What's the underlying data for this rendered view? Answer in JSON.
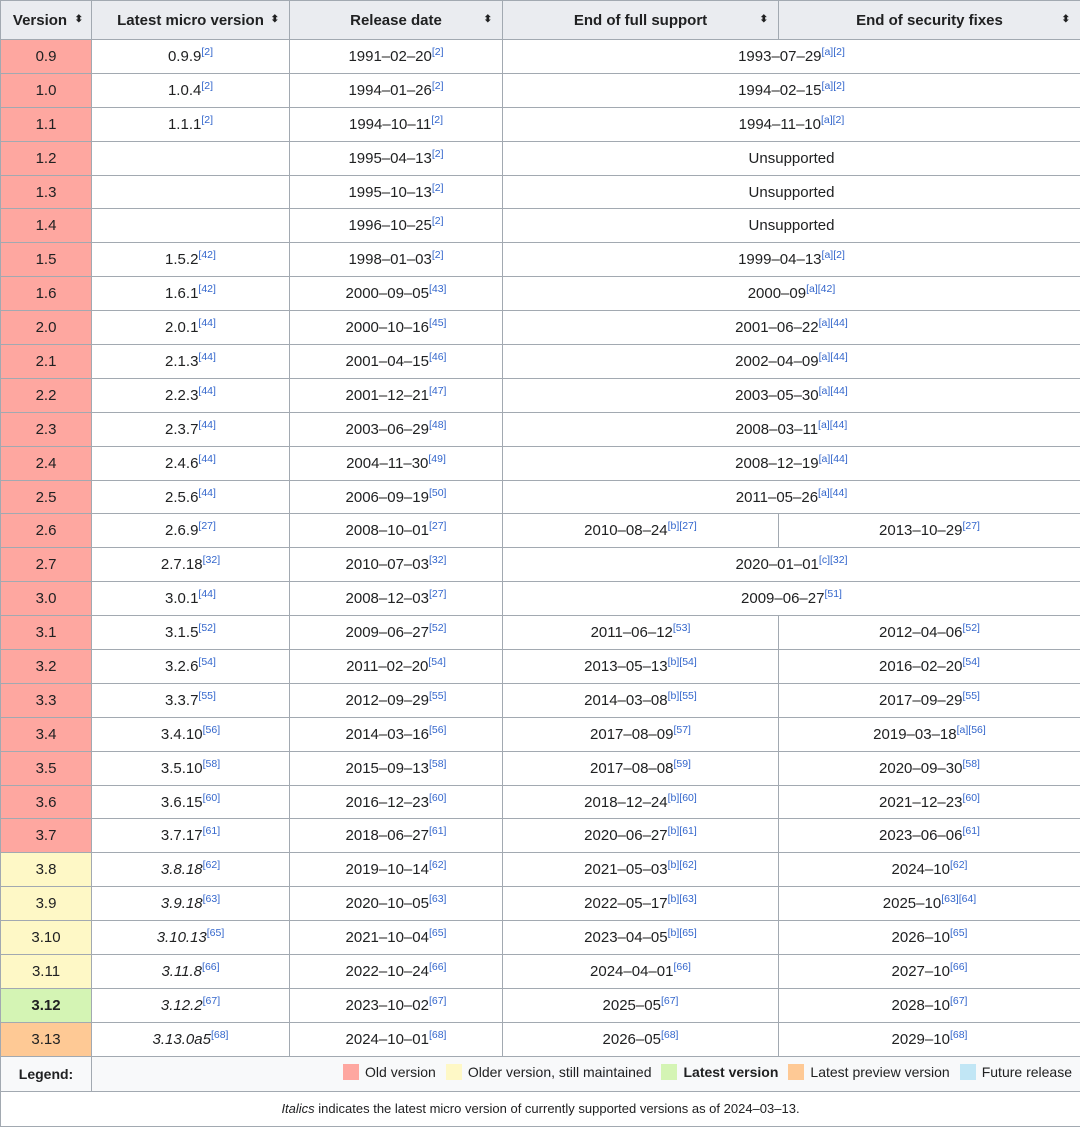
{
  "colors": {
    "old": "#fea7a0",
    "older_maintained": "#fef8c6",
    "latest": "#d4f4b4",
    "preview": "#fec995",
    "future": "#c1e6f5",
    "header_bg": "#eaecf0",
    "link": "#3366cc"
  },
  "headers": {
    "version": "Version",
    "micro": "Latest micro version",
    "release": "Release date",
    "full_support": "End of full support",
    "security": "End of security fixes",
    "sort_icon": "⬍"
  },
  "rows": [
    {
      "version": "0.9",
      "status": "old",
      "micro": "0.9.9",
      "micro_ref": "[2]",
      "micro_italic": false,
      "release": "1991–02–20",
      "release_ref": "[2]",
      "merged": true,
      "eol": "1993–07–29",
      "eol_ref": "[a][2]"
    },
    {
      "version": "1.0",
      "status": "old",
      "micro": "1.0.4",
      "micro_ref": "[2]",
      "micro_italic": false,
      "release": "1994–01–26",
      "release_ref": "[2]",
      "merged": true,
      "eol": "1994–02–15",
      "eol_ref": "[a][2]"
    },
    {
      "version": "1.1",
      "status": "old",
      "micro": "1.1.1",
      "micro_ref": "[2]",
      "micro_italic": false,
      "release": "1994–10–11",
      "release_ref": "[2]",
      "merged": true,
      "eol": "1994–11–10",
      "eol_ref": "[a][2]"
    },
    {
      "version": "1.2",
      "status": "old",
      "micro": "",
      "micro_ref": "",
      "micro_italic": false,
      "release": "1995–04–13",
      "release_ref": "[2]",
      "merged": true,
      "eol": "Unsupported",
      "eol_ref": ""
    },
    {
      "version": "1.3",
      "status": "old",
      "micro": "",
      "micro_ref": "",
      "micro_italic": false,
      "release": "1995–10–13",
      "release_ref": "[2]",
      "merged": true,
      "eol": "Unsupported",
      "eol_ref": ""
    },
    {
      "version": "1.4",
      "status": "old",
      "micro": "",
      "micro_ref": "",
      "micro_italic": false,
      "release": "1996–10–25",
      "release_ref": "[2]",
      "merged": true,
      "eol": "Unsupported",
      "eol_ref": ""
    },
    {
      "version": "1.5",
      "status": "old",
      "micro": "1.5.2",
      "micro_ref": "[42]",
      "micro_italic": false,
      "release": "1998–01–03",
      "release_ref": "[2]",
      "merged": true,
      "eol": "1999–04–13",
      "eol_ref": "[a][2]"
    },
    {
      "version": "1.6",
      "status": "old",
      "micro": "1.6.1",
      "micro_ref": "[42]",
      "micro_italic": false,
      "release": "2000–09–05",
      "release_ref": "[43]",
      "merged": true,
      "eol": "2000–09",
      "eol_ref": "[a][42]"
    },
    {
      "version": "2.0",
      "status": "old",
      "micro": "2.0.1",
      "micro_ref": "[44]",
      "micro_italic": false,
      "release": "2000–10–16",
      "release_ref": "[45]",
      "merged": true,
      "eol": "2001–06–22",
      "eol_ref": "[a][44]"
    },
    {
      "version": "2.1",
      "status": "old",
      "micro": "2.1.3",
      "micro_ref": "[44]",
      "micro_italic": false,
      "release": "2001–04–15",
      "release_ref": "[46]",
      "merged": true,
      "eol": "2002–04–09",
      "eol_ref": "[a][44]"
    },
    {
      "version": "2.2",
      "status": "old",
      "micro": "2.2.3",
      "micro_ref": "[44]",
      "micro_italic": false,
      "release": "2001–12–21",
      "release_ref": "[47]",
      "merged": true,
      "eol": "2003–05–30",
      "eol_ref": "[a][44]"
    },
    {
      "version": "2.3",
      "status": "old",
      "micro": "2.3.7",
      "micro_ref": "[44]",
      "micro_italic": false,
      "release": "2003–06–29",
      "release_ref": "[48]",
      "merged": true,
      "eol": "2008–03–11",
      "eol_ref": "[a][44]"
    },
    {
      "version": "2.4",
      "status": "old",
      "micro": "2.4.6",
      "micro_ref": "[44]",
      "micro_italic": false,
      "release": "2004–11–30",
      "release_ref": "[49]",
      "merged": true,
      "eol": "2008–12–19",
      "eol_ref": "[a][44]"
    },
    {
      "version": "2.5",
      "status": "old",
      "micro": "2.5.6",
      "micro_ref": "[44]",
      "micro_italic": false,
      "release": "2006–09–19",
      "release_ref": "[50]",
      "merged": true,
      "eol": "2011–05–26",
      "eol_ref": "[a][44]"
    },
    {
      "version": "2.6",
      "status": "old",
      "micro": "2.6.9",
      "micro_ref": "[27]",
      "micro_italic": false,
      "release": "2008–10–01",
      "release_ref": "[27]",
      "merged": false,
      "full": "2010–08–24",
      "full_ref": "[b][27]",
      "sec": "2013–10–29",
      "sec_ref": "[27]"
    },
    {
      "version": "2.7",
      "status": "old",
      "micro": "2.7.18",
      "micro_ref": "[32]",
      "micro_italic": false,
      "release": "2010–07–03",
      "release_ref": "[32]",
      "merged": true,
      "eol": "2020–01–01",
      "eol_ref": "[c][32]"
    },
    {
      "version": "3.0",
      "status": "old",
      "micro": "3.0.1",
      "micro_ref": "[44]",
      "micro_italic": false,
      "release": "2008–12–03",
      "release_ref": "[27]",
      "merged": true,
      "eol": "2009–06–27",
      "eol_ref": "[51]"
    },
    {
      "version": "3.1",
      "status": "old",
      "micro": "3.1.5",
      "micro_ref": "[52]",
      "micro_italic": false,
      "release": "2009–06–27",
      "release_ref": "[52]",
      "merged": false,
      "full": "2011–06–12",
      "full_ref": "[53]",
      "sec": "2012–04–06",
      "sec_ref": "[52]"
    },
    {
      "version": "3.2",
      "status": "old",
      "micro": "3.2.6",
      "micro_ref": "[54]",
      "micro_italic": false,
      "release": "2011–02–20",
      "release_ref": "[54]",
      "merged": false,
      "full": "2013–05–13",
      "full_ref": "[b][54]",
      "sec": "2016–02–20",
      "sec_ref": "[54]"
    },
    {
      "version": "3.3",
      "status": "old",
      "micro": "3.3.7",
      "micro_ref": "[55]",
      "micro_italic": false,
      "release": "2012–09–29",
      "release_ref": "[55]",
      "merged": false,
      "full": "2014–03–08",
      "full_ref": "[b][55]",
      "sec": "2017–09–29",
      "sec_ref": "[55]"
    },
    {
      "version": "3.4",
      "status": "old",
      "micro": "3.4.10",
      "micro_ref": "[56]",
      "micro_italic": false,
      "release": "2014–03–16",
      "release_ref": "[56]",
      "merged": false,
      "full": "2017–08–09",
      "full_ref": "[57]",
      "sec": "2019–03–18",
      "sec_ref": "[a][56]"
    },
    {
      "version": "3.5",
      "status": "old",
      "micro": "3.5.10",
      "micro_ref": "[58]",
      "micro_italic": false,
      "release": "2015–09–13",
      "release_ref": "[58]",
      "merged": false,
      "full": "2017–08–08",
      "full_ref": "[59]",
      "sec": "2020–09–30",
      "sec_ref": "[58]"
    },
    {
      "version": "3.6",
      "status": "old",
      "micro": "3.6.15",
      "micro_ref": "[60]",
      "micro_italic": false,
      "release": "2016–12–23",
      "release_ref": "[60]",
      "merged": false,
      "full": "2018–12–24",
      "full_ref": "[b][60]",
      "sec": "2021–12–23",
      "sec_ref": "[60]"
    },
    {
      "version": "3.7",
      "status": "old",
      "micro": "3.7.17",
      "micro_ref": "[61]",
      "micro_italic": false,
      "release": "2018–06–27",
      "release_ref": "[61]",
      "merged": false,
      "full": "2020–06–27",
      "full_ref": "[b][61]",
      "sec": "2023–06–06",
      "sec_ref": "[61]"
    },
    {
      "version": "3.8",
      "status": "older_maintained",
      "micro": "3.8.18",
      "micro_ref": "[62]",
      "micro_italic": true,
      "release": "2019–10–14",
      "release_ref": "[62]",
      "merged": false,
      "full": "2021–05–03",
      "full_ref": "[b][62]",
      "sec": "2024–10",
      "sec_ref": "[62]"
    },
    {
      "version": "3.9",
      "status": "older_maintained",
      "micro": "3.9.18",
      "micro_ref": "[63]",
      "micro_italic": true,
      "release": "2020–10–05",
      "release_ref": "[63]",
      "merged": false,
      "full": "2022–05–17",
      "full_ref": "[b][63]",
      "sec": "2025–10",
      "sec_ref": "[63][64]"
    },
    {
      "version": "3.10",
      "status": "older_maintained",
      "micro": "3.10.13",
      "micro_ref": "[65]",
      "micro_italic": true,
      "release": "2021–10–04",
      "release_ref": "[65]",
      "merged": false,
      "full": "2023–04–05",
      "full_ref": "[b][65]",
      "sec": "2026–10",
      "sec_ref": "[65]"
    },
    {
      "version": "3.11",
      "status": "older_maintained",
      "micro": "3.11.8",
      "micro_ref": "[66]",
      "micro_italic": true,
      "release": "2022–10–24",
      "release_ref": "[66]",
      "merged": false,
      "full": "2024–04–01",
      "full_ref": "[66]",
      "sec": "2027–10",
      "sec_ref": "[66]"
    },
    {
      "version": "3.12",
      "status": "latest",
      "micro": "3.12.2",
      "micro_ref": "[67]",
      "micro_italic": true,
      "release": "2023–10–02",
      "release_ref": "[67]",
      "merged": false,
      "full": "2025–05",
      "full_ref": "[67]",
      "sec": "2028–10",
      "sec_ref": "[67]"
    },
    {
      "version": "3.13",
      "status": "preview",
      "micro": "3.13.0a5",
      "micro_ref": "[68]",
      "micro_italic": true,
      "release": "2024–10–01",
      "release_ref": "[68]",
      "merged": false,
      "full": "2026–05",
      "full_ref": "[68]",
      "sec": "2029–10",
      "sec_ref": "[68]"
    }
  ],
  "legend": {
    "label": "Legend:",
    "items": [
      {
        "key": "old",
        "text": "Old version",
        "bold": false
      },
      {
        "key": "older_maintained",
        "text": "Older version, still maintained",
        "bold": false
      },
      {
        "key": "latest",
        "text": "Latest version",
        "bold": true
      },
      {
        "key": "preview",
        "text": "Latest preview version",
        "bold": false
      },
      {
        "key": "future",
        "text": "Future release",
        "bold": false
      }
    ]
  },
  "note": {
    "italic_word": "Italics",
    "rest": " indicates the latest micro version of currently supported versions as of 2024–03–13."
  }
}
